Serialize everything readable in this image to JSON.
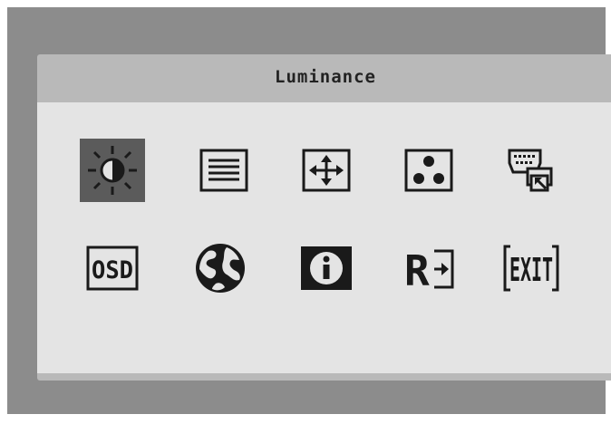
{
  "osd": {
    "title": "Luminance",
    "selected_item": "luminance",
    "menu_items": [
      {
        "id": "luminance",
        "icon": "brightness-contrast-icon"
      },
      {
        "id": "image-setup",
        "icon": "lines-icon"
      },
      {
        "id": "image-position",
        "icon": "move-arrows-icon"
      },
      {
        "id": "color-setup",
        "icon": "rgb-dots-icon"
      },
      {
        "id": "input-select",
        "icon": "connector-icon"
      },
      {
        "id": "osd-setup",
        "icon": "osd-icon",
        "label": "OSD"
      },
      {
        "id": "language",
        "icon": "globe-icon"
      },
      {
        "id": "information",
        "icon": "info-icon"
      },
      {
        "id": "reset",
        "icon": "reset-icon",
        "label": "R"
      },
      {
        "id": "exit",
        "icon": "exit-icon",
        "label": "EXIT"
      }
    ]
  },
  "colors": {
    "screen_bg": "#8c8c8c",
    "osd_frame": "#b9b9b9",
    "panel": "#e4e4e4",
    "selected": "#5b5b5b",
    "icon_stroke": "#1a1a1a"
  }
}
